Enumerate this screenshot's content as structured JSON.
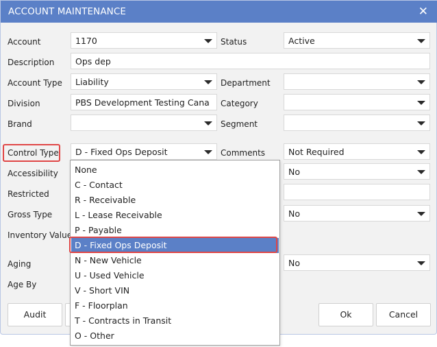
{
  "window": {
    "title": "ACCOUNT MAINTENANCE",
    "close_icon": "close-icon",
    "accent_color": "#5b80c7",
    "highlight_color": "#e04545"
  },
  "labels": {
    "account": "Account",
    "description": "Description",
    "account_type": "Account Type",
    "division": "Division",
    "brand": "Brand",
    "control_type": "Control Type",
    "accessibility": "Accessibility",
    "restricted": "Restricted",
    "gross_type": "Gross Type",
    "inventory_value": "Inventory Value",
    "aging": "Aging",
    "age_by": "Age By",
    "status": "Status",
    "department": "Department",
    "category": "Category",
    "segment": "Segment",
    "comments": "Comments"
  },
  "fields": {
    "account": "1170",
    "description": "Ops dep",
    "account_type": "Liability",
    "division": "PBS Development Testing Cana",
    "brand": "",
    "control_type": "D - Fixed Ops Deposit",
    "status": "Active",
    "department": "",
    "category": "",
    "segment": "",
    "comments": "Not Required",
    "accessibility_right": "No",
    "restricted_right": "",
    "gross_type_right": "No",
    "aging_right": "No"
  },
  "dropdown": {
    "items": [
      "None",
      "C - Contact",
      "R - Receivable",
      "L - Lease Receivable",
      "P - Payable",
      "D - Fixed Ops Deposit",
      "N - New Vehicle",
      "U - Used Vehicle",
      "V - Short VIN",
      "F - Floorplan",
      "T - Contracts in Transit",
      "O - Other"
    ],
    "selected": "D - Fixed Ops Deposit"
  },
  "buttons": {
    "audit": "Audit",
    "ok": "Ok",
    "cancel": "Cancel"
  }
}
